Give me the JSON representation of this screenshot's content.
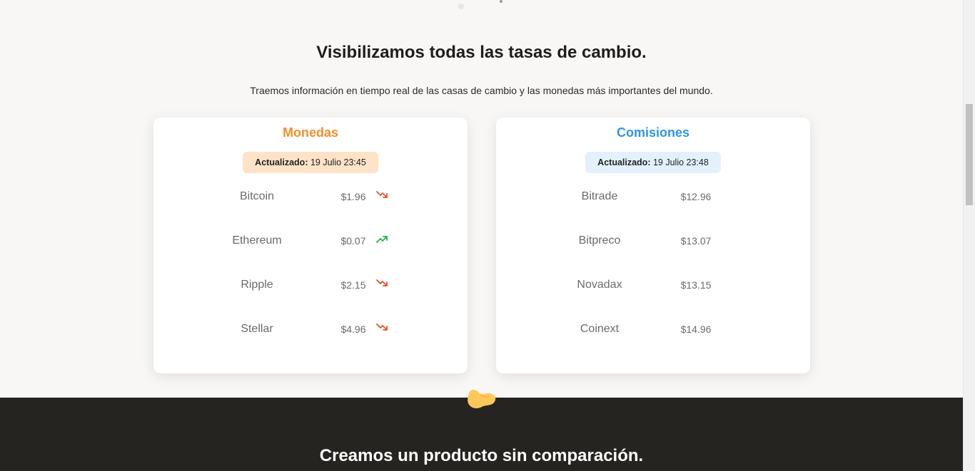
{
  "section": {
    "title": "Visibilizamos todas las tasas de cambio.",
    "subtitle": "Traemos información en tiempo real de las casas de cambio y las monedas más importantes del mundo."
  },
  "cards": {
    "monedas": {
      "title": "Monedas",
      "accent": "#ef8f2e",
      "updated_label": "Actualizado:",
      "updated_value": "19 Julio 23:45",
      "rows": [
        {
          "name": "Bitcoin",
          "price": "$1.96",
          "trend": "down"
        },
        {
          "name": "Ethereum",
          "price": "$0.07",
          "trend": "up"
        },
        {
          "name": "Ripple",
          "price": "$2.15",
          "trend": "down"
        },
        {
          "name": "Stellar",
          "price": "$4.96",
          "trend": "down"
        }
      ]
    },
    "comisiones": {
      "title": "Comisiones",
      "accent": "#2e95e6",
      "updated_label": "Actualizado:",
      "updated_value": "19 Julio 23:48",
      "rows": [
        {
          "name": "Bitrade",
          "price": "$12.96"
        },
        {
          "name": "Bitpreco",
          "price": "$13.07"
        },
        {
          "name": "Novadax",
          "price": "$13.15"
        },
        {
          "name": "Coinext",
          "price": "$14.96"
        }
      ]
    }
  },
  "footer_section": {
    "title": "Creamos un producto sin comparación.",
    "background": "#262420",
    "blob_color": "#fcc85a"
  },
  "colors": {
    "trend_up": "#22b04a",
    "trend_down": "#e5532d"
  },
  "icons": {
    "trend_up": "trending-up-icon",
    "trend_down": "trending-down-icon",
    "carousel": "carousel-dot-icon"
  }
}
